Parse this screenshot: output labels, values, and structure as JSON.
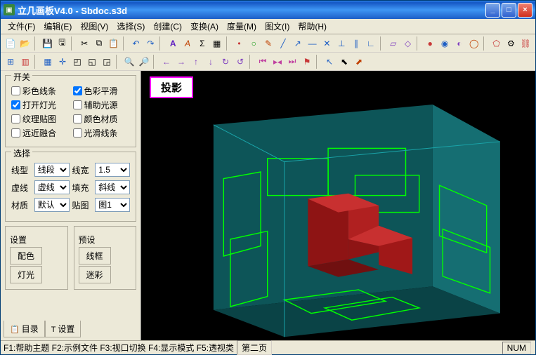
{
  "window": {
    "title": "立几画板V4.0 - Sbdoc.s3d",
    "min": "_",
    "max": "□",
    "close": "×"
  },
  "menu": {
    "file": "文件(F)",
    "edit": "编辑(E)",
    "view": "视图(V)",
    "select": "选择(S)",
    "create": "创建(C)",
    "transform": "变换(A)",
    "measure": "度量(M)",
    "text": "图文(I)",
    "help": "帮助(H)"
  },
  "sidebar": {
    "switches": {
      "title": "开关",
      "color_lines": "彩色线条",
      "smooth": "色彩平滑",
      "lights": "打开灯光",
      "aux_light": "辅助光源",
      "texture": "纹理贴图",
      "color_mat": "颜色材质",
      "fog": "远近融合",
      "glossy": "光滑线条",
      "checked": {
        "color_lines": false,
        "smooth": true,
        "lights": true,
        "aux_light": false,
        "texture": false,
        "color_mat": false,
        "fog": false,
        "glossy": false
      }
    },
    "selection": {
      "title": "选择",
      "line_type_label": "线型",
      "line_type": "线段",
      "line_width_label": "线宽",
      "line_width": "1.5",
      "dash_label": "虚线",
      "dash": "虚线",
      "fill_label": "填充",
      "fill": "斜线",
      "material_label": "材质",
      "material": "默认",
      "tile_label": "贴图",
      "tile": "图1"
    },
    "settings": {
      "col1_title": "设置",
      "col2_title": "预设",
      "btn_color": "配色",
      "btn_light": "灯光",
      "btn_wire": "线框",
      "btn_camo": "迷彩"
    },
    "tabs": {
      "catalog": "目录",
      "settings": "设置"
    }
  },
  "viewport": {
    "badge": "投影"
  },
  "status": {
    "hints": "F1:帮助主题 F2:示例文件 F3:视口切换 F4:显示模式 F5:透视类",
    "page": "第二页",
    "num": "NUM"
  },
  "icons": {
    "new": "new-icon",
    "open": "open-icon",
    "save": "save-icon",
    "cut": "cut-icon",
    "copy": "copy-icon",
    "paste": "paste-icon",
    "undo": "undo-icon",
    "redo": "redo-icon",
    "text": "text-icon"
  },
  "chart_data": {
    "type": "3d-scene",
    "note": "Teal translucent cube with green wireframe orthographic projections on left, top, back faces; solid red L-shaped block at center",
    "cube_color": "#0e6a6d",
    "wire_color": "#00ff00",
    "solid_color": "#a01818",
    "badge_outline": "#ff00ff"
  }
}
